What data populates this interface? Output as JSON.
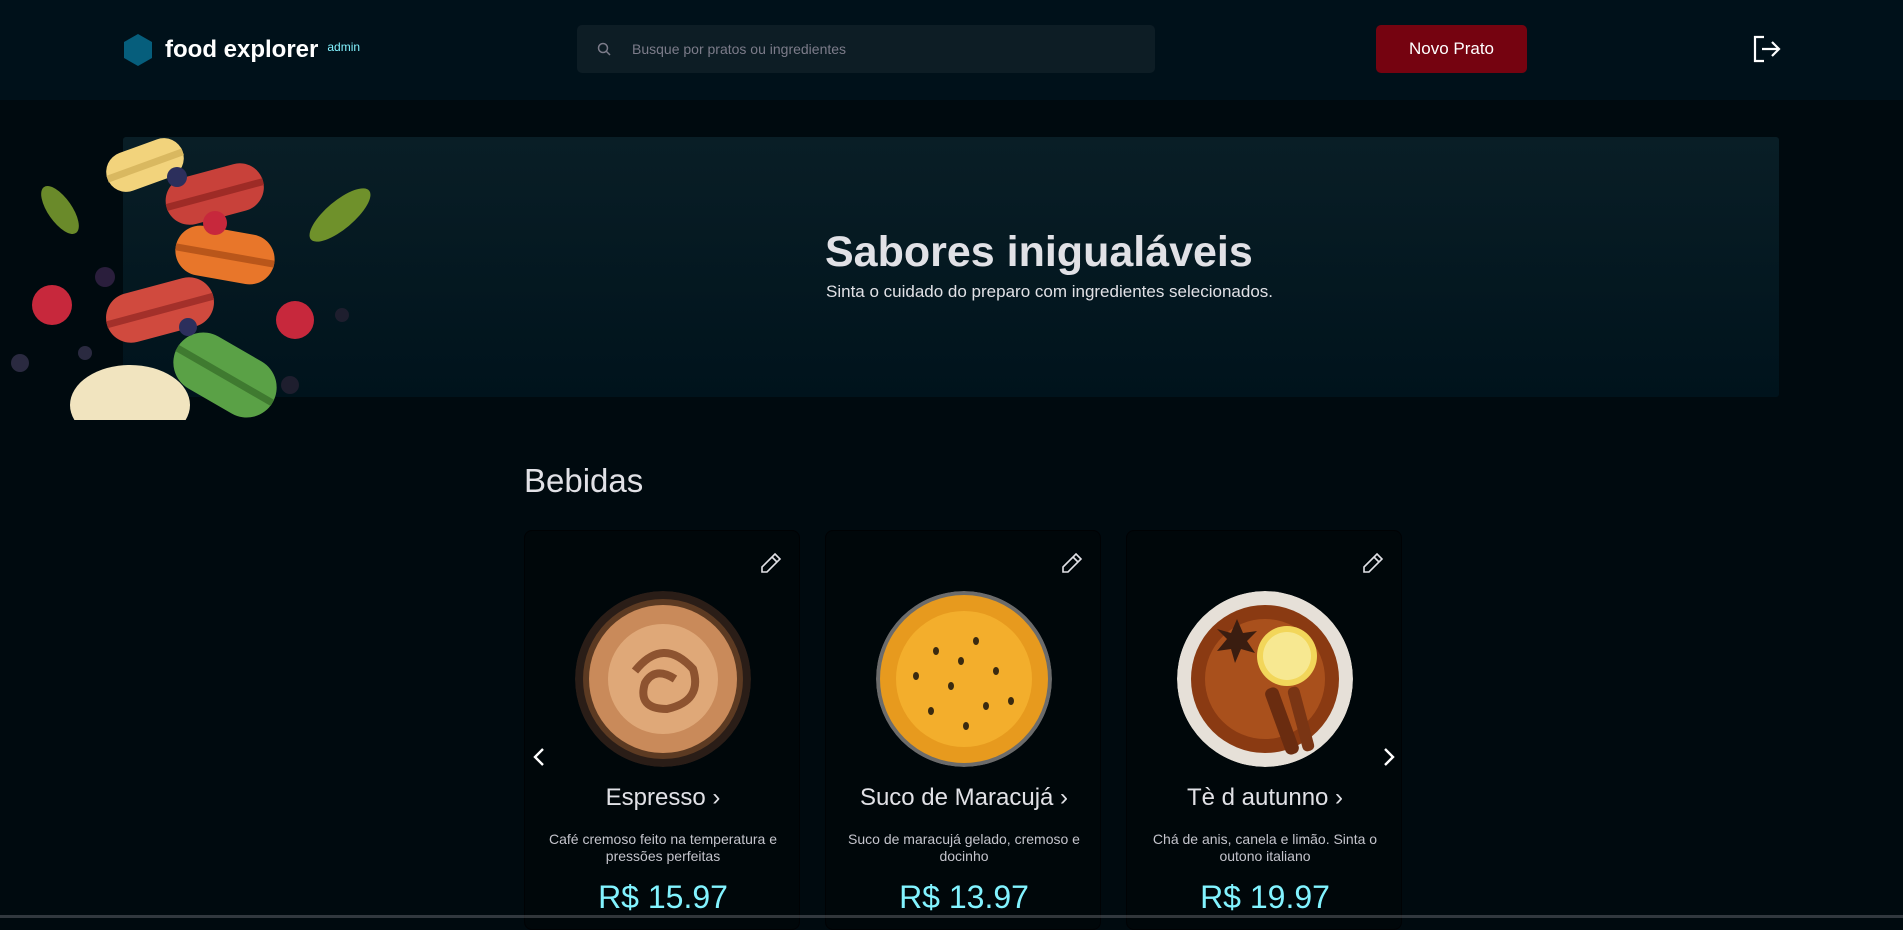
{
  "header": {
    "logo_text": "food explorer",
    "logo_badge": "admin",
    "search_placeholder": "Busque por pratos ou ingredientes",
    "new_dish_label": "Novo Prato"
  },
  "banner": {
    "title": "Sabores inigualáveis",
    "subtitle": "Sinta o cuidado do preparo com ingredientes selecionados."
  },
  "section": {
    "title": "Bebidas",
    "items": [
      {
        "name": "Espresso ›",
        "description": "Café cremoso feito na temperatura e pressões perfeitas",
        "price": "R$ 15.97"
      },
      {
        "name": "Suco de Maracujá ›",
        "description": "Suco de maracujá gelado, cremoso e docinho",
        "price": "R$ 13.97"
      },
      {
        "name": "Tè d autunno ›",
        "description": "Chá de anis, canela e limão. Sinta o outono italiano",
        "price": "R$ 19.97"
      }
    ]
  },
  "colors": {
    "background": "#000a0f",
    "header": "#00111a",
    "accent_button": "#750310",
    "price": "#82f3ff",
    "logo": "#065e7c"
  },
  "icons": [
    "hexagon-logo-icon",
    "search-icon",
    "sign-out-icon",
    "pencil-icon",
    "chevron-left-icon",
    "chevron-right-icon"
  ]
}
